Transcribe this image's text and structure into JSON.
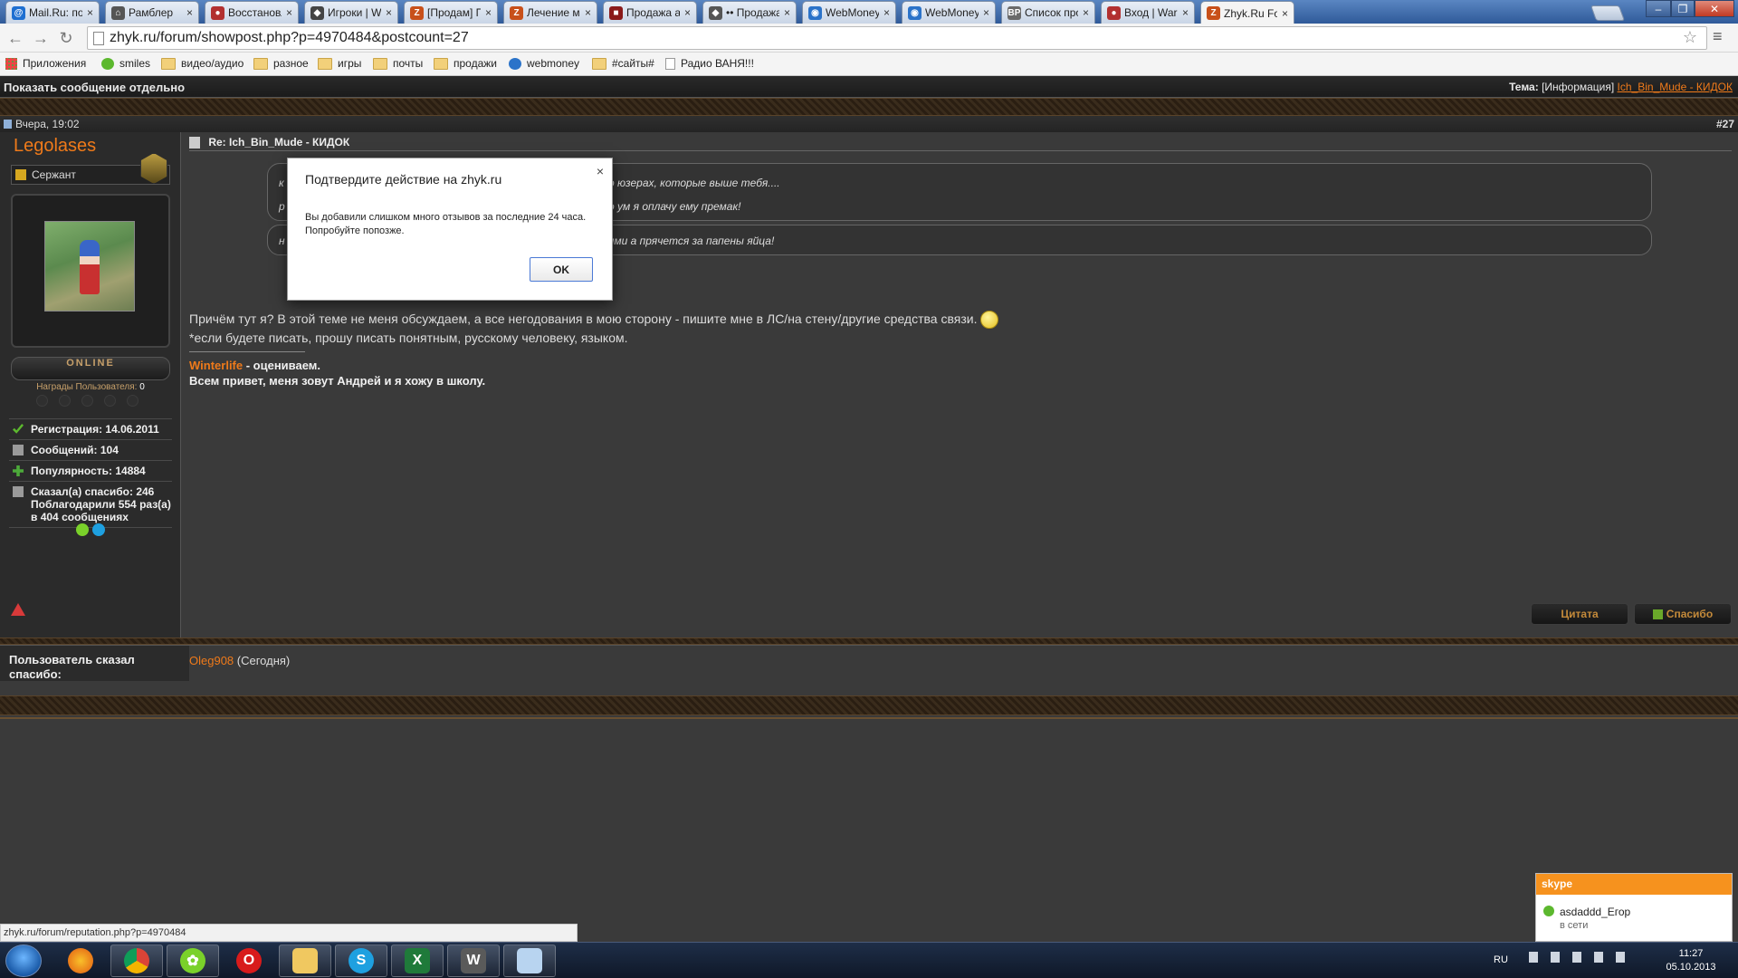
{
  "tabs": [
    {
      "title": "Mail.Ru: почта,",
      "fav": "mailru-icon",
      "color": "#1e6fd1",
      "glyph": "@",
      "active": false
    },
    {
      "title": "Рамблер",
      "fav": "home-icon",
      "color": "#555555",
      "glyph": "⌂",
      "active": false
    },
    {
      "title": "Восстановлен",
      "fav": "wargaming-icon",
      "color": "#b23030",
      "glyph": "●",
      "active": false
    },
    {
      "title": "Игроки | Worl",
      "fav": "shield-icon",
      "color": "#444444",
      "glyph": "◆",
      "active": false
    },
    {
      "title": "[Продам] Про",
      "fav": "zhyk-icon",
      "color": "#c8501a",
      "glyph": "Z",
      "active": false
    },
    {
      "title": "Лечение моде",
      "fav": "zhyk-icon",
      "color": "#c8501a",
      "glyph": "Z",
      "active": false
    },
    {
      "title": "Продажа акка",
      "fav": "ebay-icon",
      "color": "#8a1a1a",
      "glyph": "■",
      "active": false
    },
    {
      "title": "•• Продажа ак",
      "fav": "shield-icon",
      "color": "#555555",
      "glyph": "◆",
      "active": false
    },
    {
      "title": "WebMoney - сі",
      "fav": "webmoney-icon",
      "color": "#2b73c9",
      "glyph": "◉",
      "active": false
    },
    {
      "title": "WebMoney Ко",
      "fav": "webmoney-icon",
      "color": "#2b73c9",
      "glyph": "◉",
      "active": false
    },
    {
      "title": "Список прокс",
      "fav": "bp-icon",
      "color": "#6a6a6a",
      "glyph": "BP",
      "active": false
    },
    {
      "title": "Вход | Wargam",
      "fav": "wargaming-icon",
      "color": "#b23030",
      "glyph": "●",
      "active": false
    },
    {
      "title": "Zhyk.Ru Forum",
      "fav": "zhyk-icon",
      "color": "#c8501a",
      "glyph": "Z",
      "active": true
    }
  ],
  "address": {
    "url": "zhyk.ru/forum/showpost.php?p=4970484&postcount=27"
  },
  "bookmarks": [
    {
      "label": "Приложения",
      "icon": "apps-icon"
    },
    {
      "label": "smiles",
      "icon": "smiles-icon"
    },
    {
      "label": "видео/аудио",
      "icon": "folder-icon"
    },
    {
      "label": "разное",
      "icon": "folder-icon"
    },
    {
      "label": "игры",
      "icon": "folder-icon"
    },
    {
      "label": "почты",
      "icon": "folder-icon"
    },
    {
      "label": "продажи",
      "icon": "folder-icon"
    },
    {
      "label": "webmoney",
      "icon": "webmoney-icon"
    },
    {
      "label": "#сайты#",
      "icon": "folder-icon"
    },
    {
      "label": "Радио ВАНЯ!!!",
      "icon": "page-icon"
    }
  ],
  "forum": {
    "show_single": "Показать сообщение отдельно",
    "theme_label": "Тема:",
    "theme_tag": "[Информация]",
    "theme_link": "Ich_Bin_Mude - КИДОК",
    "date": "Вчера, 19:02",
    "post_number": "#27",
    "post_title": "Re: Ich_Bin_Mude - КИДОК",
    "user": {
      "name": "Legolases",
      "rank": "Сержант",
      "online": "ONLINE",
      "awards_label": "Награды Пользователя:",
      "awards_count": "0",
      "stats": [
        {
          "text": "Регистрация: 14.06.2011",
          "icon": "check-icon"
        },
        {
          "text": "Сообщений: 104",
          "icon": "posts-icon"
        },
        {
          "text": "Популярность: 14884",
          "icon": "plus-icon"
        },
        {
          "text": "Сказал(а) спасибо: 246 Поблагодарили 554 раз(а) в 404 сообщениях",
          "icon": "thanks-icon"
        }
      ]
    },
    "quote1_line1": "о юзерах, которые выше тебя....",
    "quote1_line2": "о ум я оплачу ему премак!",
    "quote1_start1": "к",
    "quote1_start2": "р",
    "quote2_text": "ями а прячется за папены яйца!",
    "quote2_start": "н",
    "body_line1": "Причём тут я? В этой теме не меня обсуждаем, а все негодования в мою сторону - пишите мне в ЛС/на стену/другие средства связи.",
    "body_line2": "*если будете писать, прошу писать понятным, русскому человеку, языком.",
    "sig_link": "Winterlife",
    "sig_rest": " - оцениваем.",
    "sig_line2": "Всем привет, меня зовут Андрей и я хожу в школу.",
    "btn_quote": "Цитата",
    "btn_thanks": "Спасибо",
    "thanks_label": "Пользователь сказал спасибо:",
    "thanks_user": "Oleg908",
    "thanks_when": "(Сегодня)"
  },
  "dialog": {
    "title": "Подтвердите действие на zhyk.ru",
    "message": "Вы добавили слишком много отзывов за последние 24 часа. Попробуйте попозже.",
    "ok": "OK",
    "close": "×"
  },
  "status_url": "zhyk.ru/forum/reputation.php?p=4970484",
  "skype": {
    "header": "skype",
    "name": "asdaddd_Егор",
    "status": "в сети"
  },
  "tray": {
    "lang": "RU",
    "time": "11:27",
    "date": "05.10.2013"
  },
  "colors": {
    "accent": "#ef7a1a",
    "dialog_button_border": "#4b7ad6",
    "skype": "#f6921e"
  }
}
